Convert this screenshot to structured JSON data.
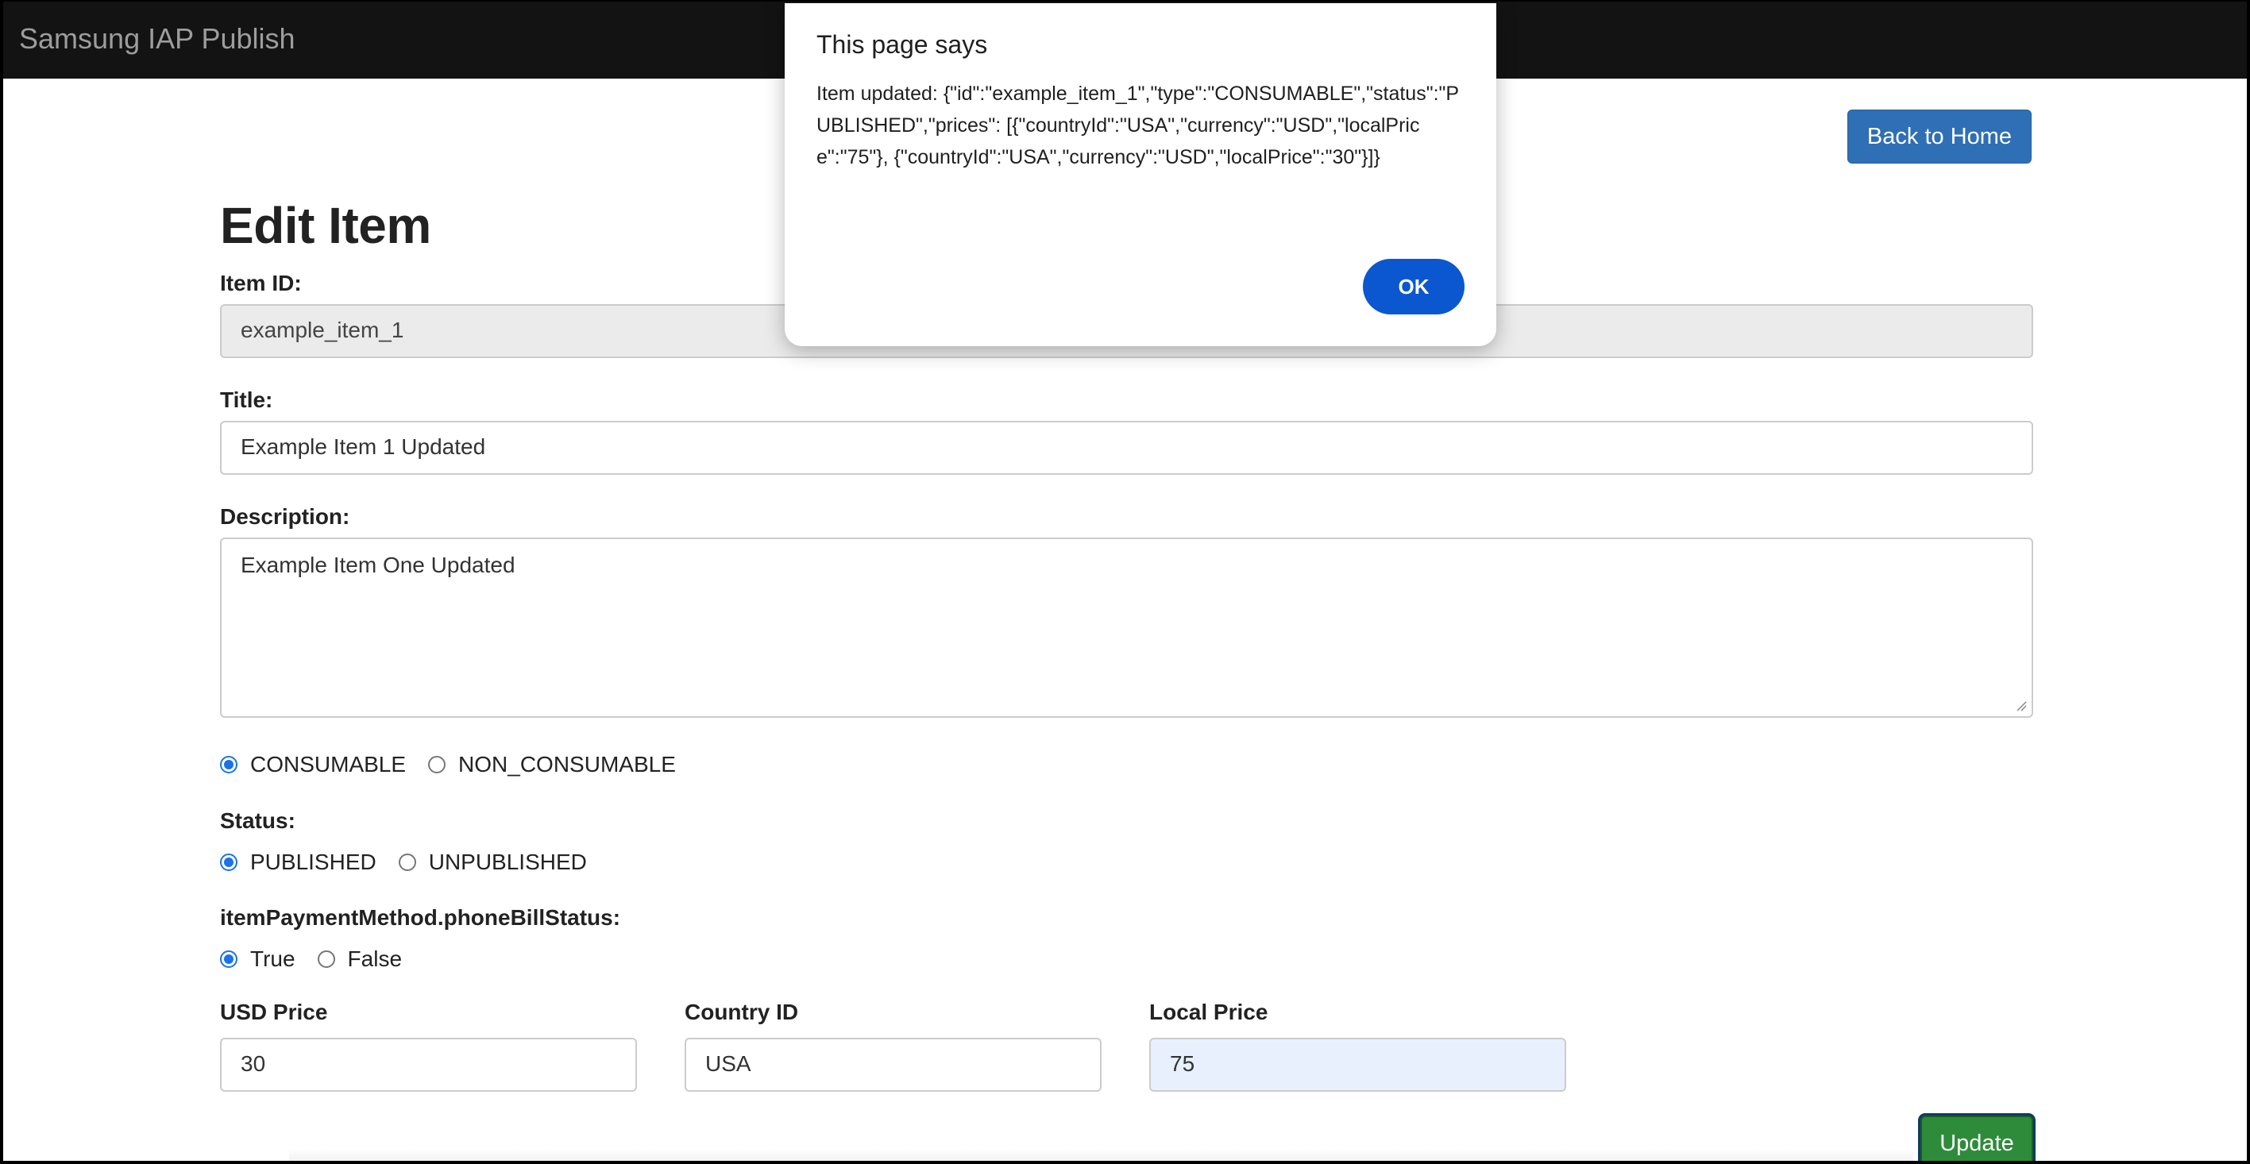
{
  "navbar": {
    "brand": "Samsung IAP Publish"
  },
  "header": {
    "back_label": "Back to Home",
    "page_title": "Edit Item"
  },
  "form": {
    "item_id": {
      "label": "Item ID:",
      "value": "example_item_1"
    },
    "title": {
      "label": "Title:",
      "value": "Example Item 1 Updated"
    },
    "description": {
      "label": "Description:",
      "value": "Example Item One Updated"
    },
    "type": {
      "options": [
        "CONSUMABLE",
        "NON_CONSUMABLE"
      ],
      "selected": "CONSUMABLE"
    },
    "status": {
      "label": "Status:",
      "options": [
        "PUBLISHED",
        "UNPUBLISHED"
      ],
      "selected": "PUBLISHED"
    },
    "phone_bill": {
      "label": "itemPaymentMethod.phoneBillStatus:",
      "options": [
        "True",
        "False"
      ],
      "selected": "True"
    },
    "usd_price": {
      "label": "USD Price",
      "value": "30"
    },
    "country_id": {
      "label": "Country ID",
      "value": "USA"
    },
    "local_price": {
      "label": "Local Price",
      "value": "75"
    },
    "update_label": "Update"
  },
  "dialog": {
    "title": "This page says",
    "message": "Item updated: {\"id\":\"example_item_1\",\"type\":\"CONSUMABLE\",\"status\":\"PUBLISHED\",\"prices\": [{\"countryId\":\"USA\",\"currency\":\"USD\",\"localPrice\":\"75\"}, {\"countryId\":\"USA\",\"currency\":\"USD\",\"localPrice\":\"30\"}]}",
    "ok_label": "OK"
  },
  "colors": {
    "navbar_bg": "#131313",
    "primary_button": "#2e6fb5",
    "update_button": "#2e8b3a",
    "dialog_ok": "#0b57d0",
    "radio_accent": "#1a73e8"
  }
}
